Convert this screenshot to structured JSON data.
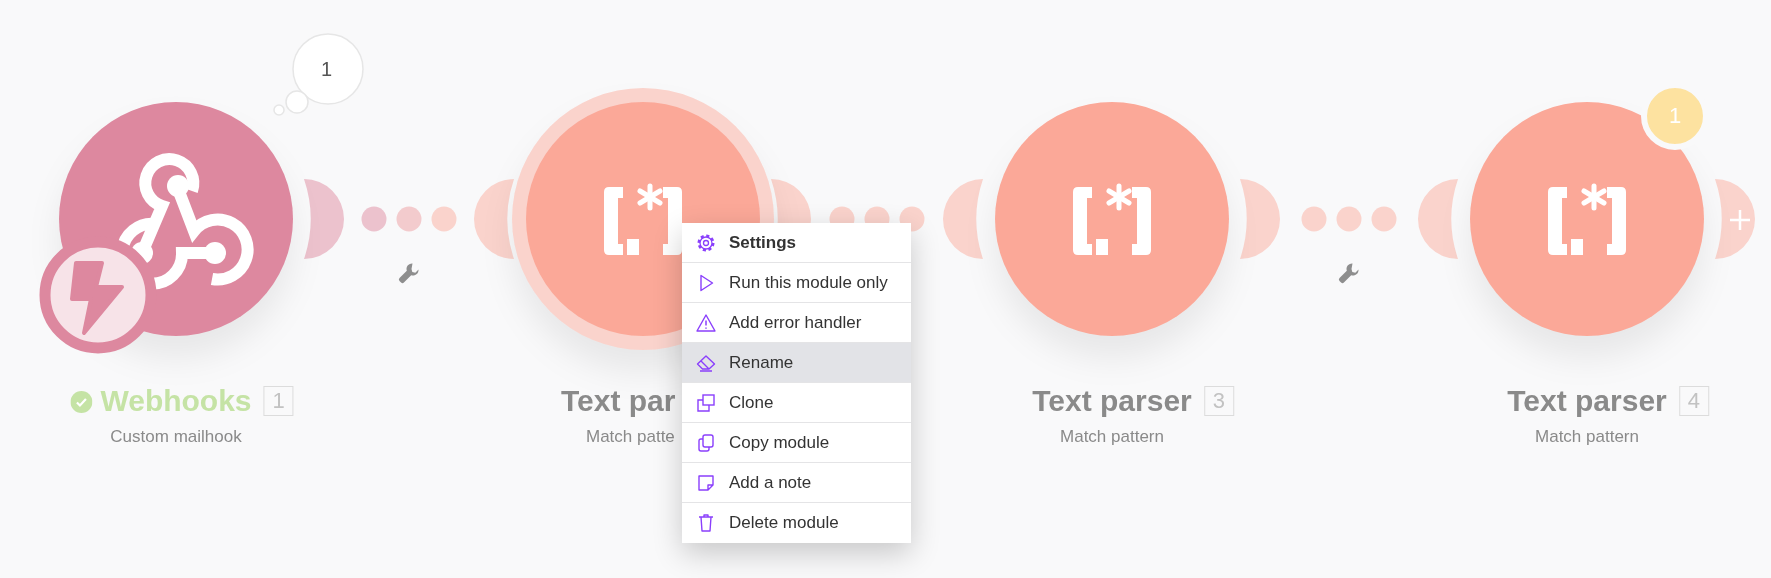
{
  "modules": [
    {
      "kind": "webhook",
      "name": "Webhooks",
      "number": "1",
      "subtitle": "Custom mailhook",
      "success": true,
      "instant": true,
      "bubble": "1",
      "selected": false,
      "output_port": true
    },
    {
      "kind": "text-parser",
      "name": "Text par",
      "subtitle": "Match patte",
      "selected": true,
      "input_port": true,
      "output_port": true
    },
    {
      "kind": "text-parser",
      "name": "Text parser",
      "number": "3",
      "subtitle": "Match pattern",
      "selected": false,
      "input_port": true,
      "output_port": true
    },
    {
      "kind": "text-parser",
      "name": "Text parser",
      "number": "4",
      "subtitle": "Match pattern",
      "badge": "1",
      "selected": false,
      "input_port": true,
      "output_port": true,
      "add_next": true
    }
  ],
  "connections": [
    {
      "filter": true
    },
    {
      "filter": false
    },
    {
      "filter": true
    }
  ],
  "context_menu": {
    "items": [
      {
        "kind": "settings",
        "label": "Settings",
        "default": true,
        "selected": false
      },
      {
        "kind": "run",
        "label": "Run this module only",
        "default": false,
        "selected": false
      },
      {
        "kind": "error-handler",
        "label": "Add error handler",
        "default": false,
        "selected": false
      },
      {
        "kind": "rename",
        "label": "Rename",
        "default": false,
        "selected": true
      },
      {
        "kind": "clone",
        "label": "Clone",
        "default": false,
        "selected": false
      },
      {
        "kind": "copy",
        "label": "Copy module",
        "default": false,
        "selected": false
      },
      {
        "kind": "note",
        "label": "Add a note",
        "default": false,
        "selected": false
      },
      {
        "kind": "delete",
        "label": "Delete module",
        "default": false,
        "selected": false
      }
    ]
  }
}
